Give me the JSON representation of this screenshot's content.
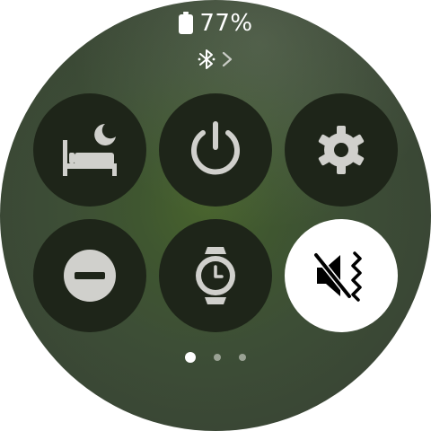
{
  "status": {
    "battery_percent": "77%",
    "battery_icon": "battery-icon",
    "bluetooth_icon": "bluetooth-icon",
    "chevron_icon": "chevron-right-icon"
  },
  "tiles": [
    {
      "name": "bedtime-mode",
      "icon": "bed-moon-icon",
      "active": false
    },
    {
      "name": "power",
      "icon": "power-icon",
      "active": false
    },
    {
      "name": "settings",
      "icon": "gear-icon",
      "active": false
    },
    {
      "name": "do-not-disturb",
      "icon": "minus-circle-icon",
      "active": false
    },
    {
      "name": "watch-only",
      "icon": "watch-icon",
      "active": false
    },
    {
      "name": "sound-mode",
      "icon": "mute-vibrate-icon",
      "active": true
    }
  ],
  "pagination": {
    "pages": 3,
    "current": 1
  },
  "colors": {
    "tile_bg": "#1e2519",
    "tile_active_bg": "#ffffff",
    "icon": "#d0d0cc",
    "icon_active": "#000000"
  }
}
